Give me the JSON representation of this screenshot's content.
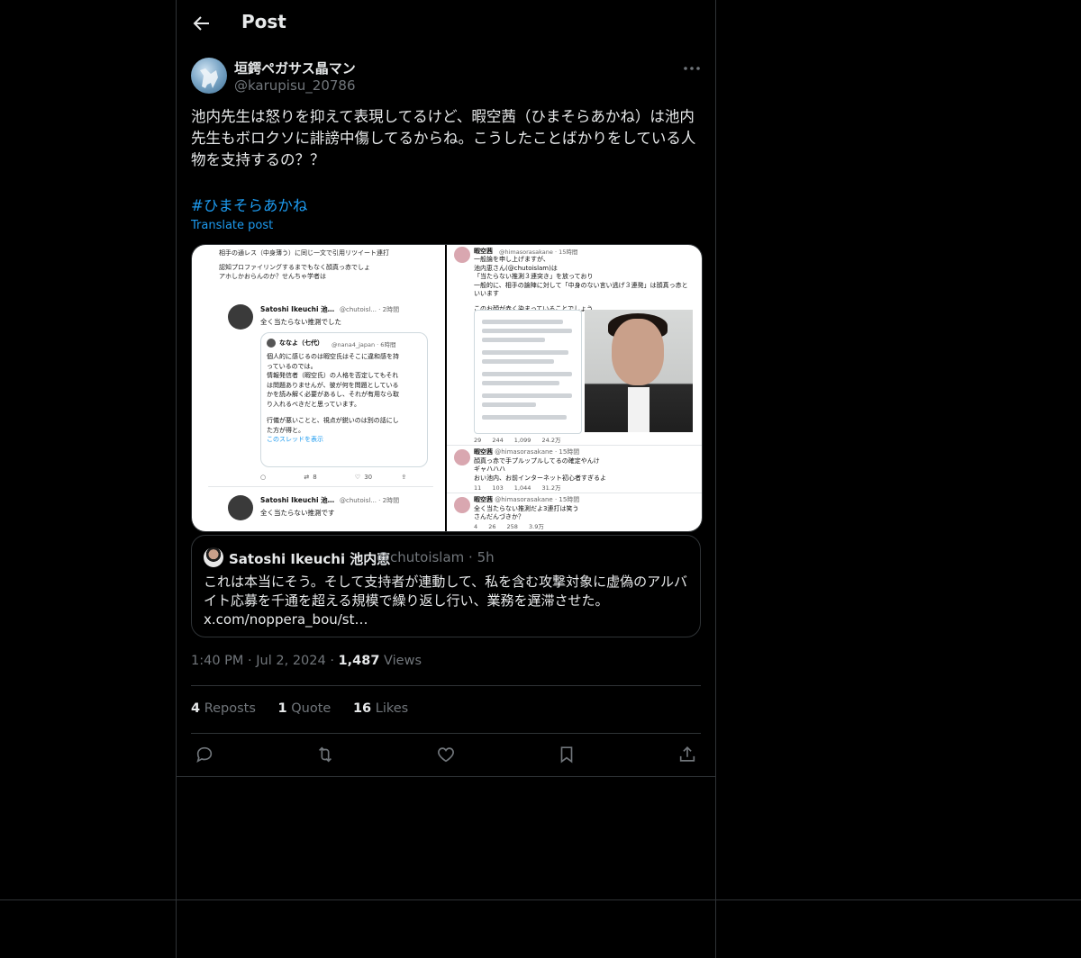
{
  "header": {
    "title": "Post"
  },
  "author": {
    "name": "垣鍔ペガサス晶マン",
    "handle": "@karupisu_20786"
  },
  "post": {
    "text": "池内先生は怒りを抑えて表現してるけど、暇空茜（ひまそらあかね）は池内先生もボロクソに誹謗中傷してるからね。こうしたことばかりをしている人物を支持するの？？",
    "hashtag": "#ひまそらあかね",
    "translate_label": "Translate post"
  },
  "media": {
    "left": {
      "top_text_1": "相手の通レス（中身薄う）に同じ一文で引用リツイート連打",
      "top_text_2": "認知プロファイリングするまでもなく顔真っ赤でしょ",
      "top_text_3": "アホしかおらんのか？せんちゃ学者は",
      "reply1_name": "Satoshi Ikeuchi 池…",
      "reply1_handle": "@chutoisl... · 2時間",
      "reply1_text": "全く当たらない推測でした",
      "inner_name": "ななよ（七代）",
      "inner_handle": "@nana4_japan · 6時間",
      "inner_text_1": "個人的に感じるのは暇空氏はそこに違和感を持",
      "inner_text_2": "っているのでは。",
      "inner_text_3": "情報発信者（暇空氏）の人格を否定してもそれ",
      "inner_text_4": "は問題ありませんが、彼が何を問題としている",
      "inner_text_5": "かを読み解く必要があるし、それが有用なら取",
      "inner_text_6": "り入れるべきだと思っています。",
      "inner_text_7": "行儀が悪いことと、視点が鋭いのは別の話にし",
      "inner_text_8": "た方が得と。",
      "inner_link": "このスレッドを表示",
      "retweets": "8",
      "likes": "30",
      "reply2_name": "Satoshi Ikeuchi 池…",
      "reply2_handle": "@chutoisl... · 2時間",
      "reply2_text": "全く当たらない推測です"
    },
    "right": {
      "name": "暇空茜",
      "handle": "@himasorasakane · 15時間",
      "text_1": "一般論を申し上げますが、",
      "text_2": "池内恵さん(@chutoislam)は",
      "text_3": "「当たらない推測３連突き」を放っており",
      "text_4": "一般的に、相手の論陣に対して「中身のない言い逃げ３連発」は顔真っ赤といいます",
      "text_5": "このお顔が赤く染まっていることでしょう",
      "stats_1": "29   244   1,099   24.2万",
      "post2_text_1": "顔真っ赤で手プルップルしてるの確定やんけ",
      "post2_text_2": "ギャハハハ",
      "post2_text_3": "おい池内、お前インターネット初心者すぎるよ",
      "stats_2": "11   103   1,044   31.2万",
      "post3_text_1": "全く当たらない推測だよ3連打は笑う",
      "post3_text_2": "さんだんづきか？",
      "stats_3": "4   26   258   3.9万"
    }
  },
  "quote": {
    "name": "Satoshi Ikeuchi 池内恵",
    "handle": "@chutoislam · 5h",
    "text": "これは本当にそう。そして支持者が連動して、私を含む攻撃対象に虚偽のアルバイト応募を千通を超える規模で繰り返し行い、業務を遅滞させた。",
    "link": "x.com/noppera_bou/st…"
  },
  "meta": {
    "time": "1:40 PM",
    "date": "Jul 2, 2024",
    "views_count": "1,487",
    "views_label": "Views",
    "dot": "·"
  },
  "stats": {
    "reposts_count": "4",
    "reposts_label": "Reposts",
    "quotes_count": "1",
    "quotes_label": "Quote",
    "likes_count": "16",
    "likes_label": "Likes"
  },
  "icons": {
    "back": "arrow-left-icon",
    "more": "more-horizontal-icon",
    "reply": "reply-icon",
    "repost": "repost-icon",
    "like": "heart-icon",
    "bookmark": "bookmark-icon",
    "share": "share-icon"
  },
  "colors": {
    "background": "#000000",
    "accent": "#1d9bf0",
    "secondary_text": "#71767b",
    "border": "#2f3336"
  }
}
